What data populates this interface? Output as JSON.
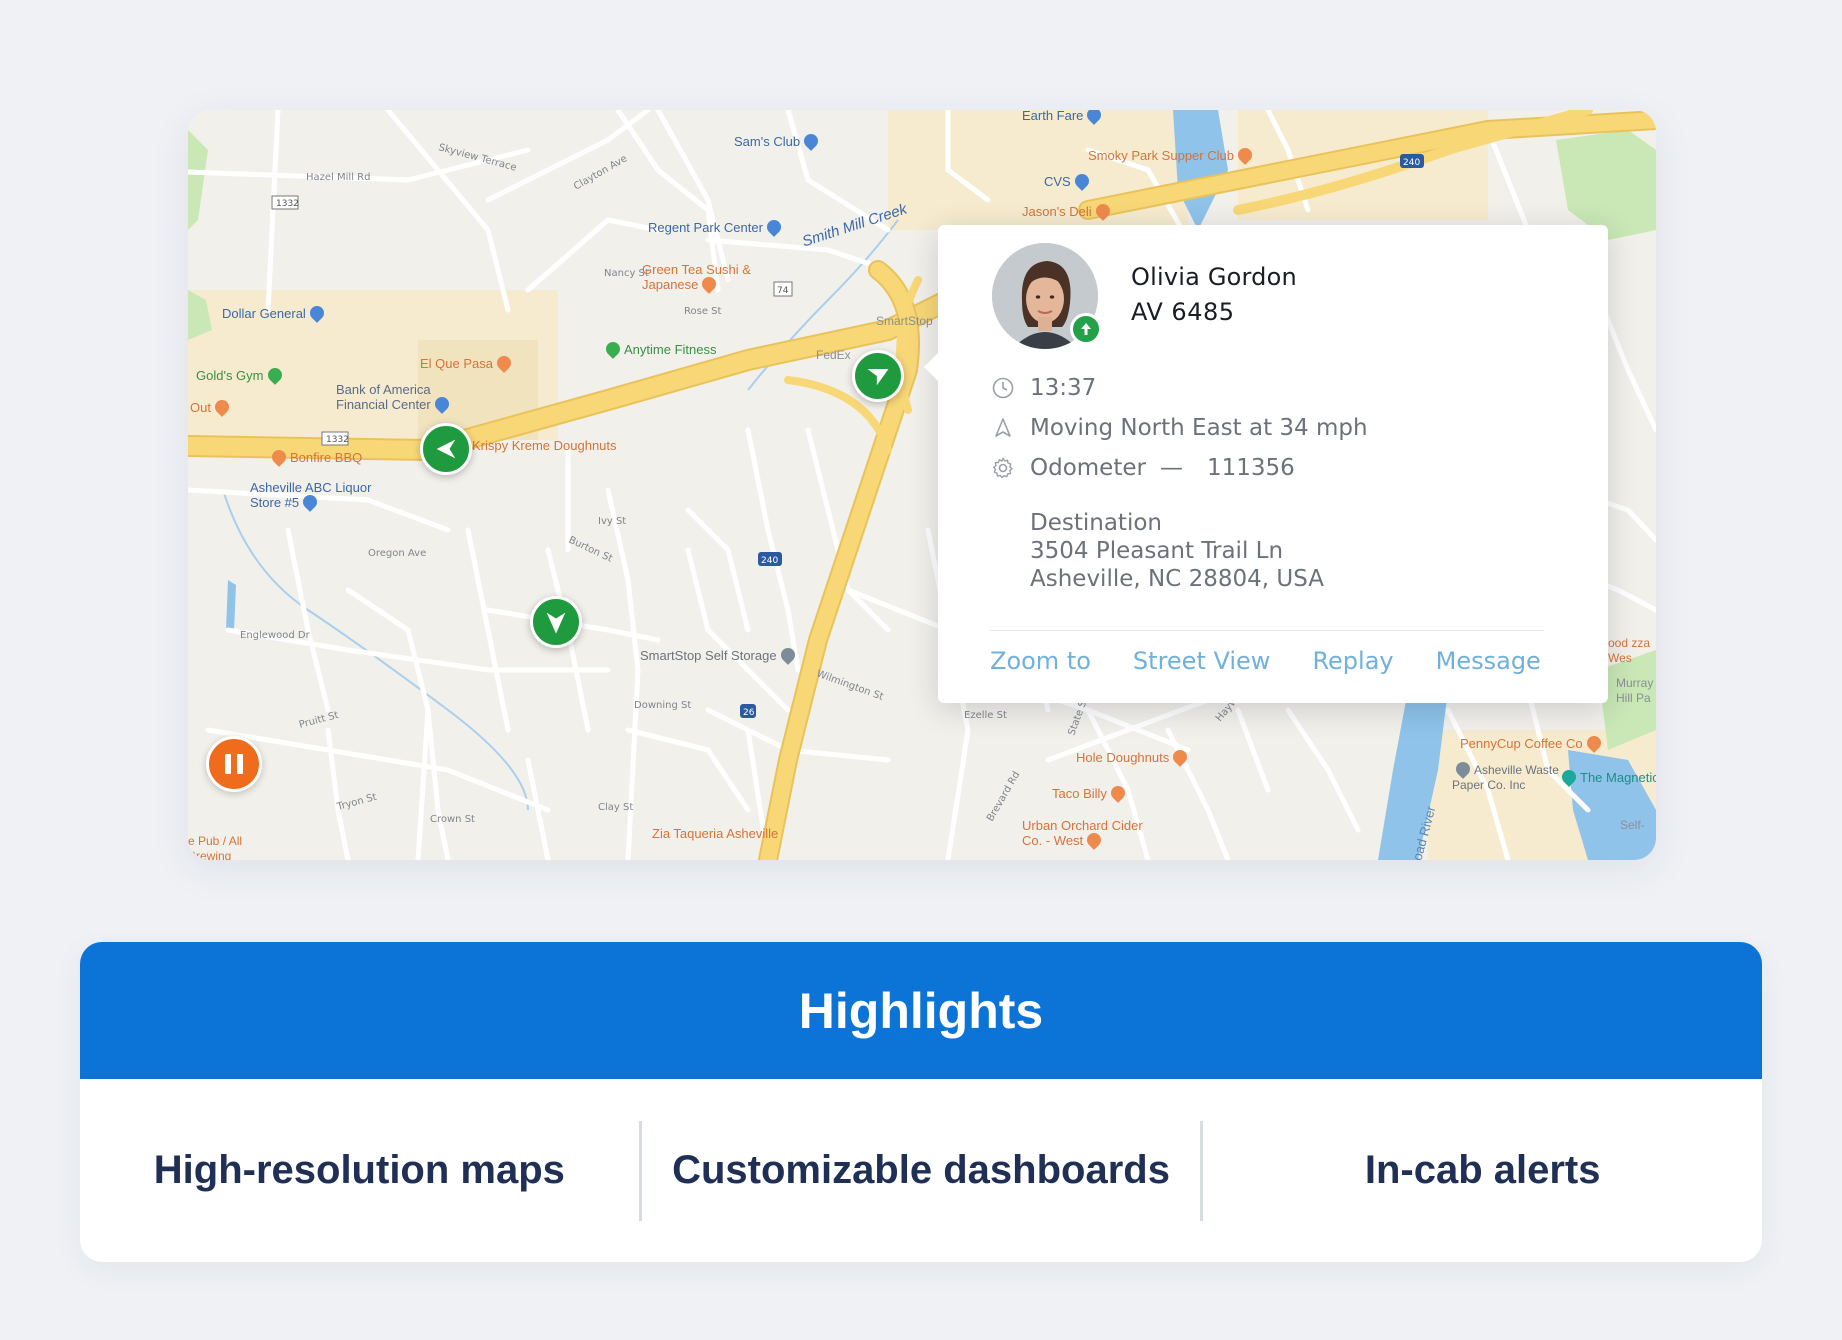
{
  "map": {
    "pois": [
      {
        "label": "Earth Fare",
        "color": "blue"
      },
      {
        "label": "Sam's Club",
        "color": "blue"
      },
      {
        "label": "Smoky Park Supper Club",
        "color": "orange"
      },
      {
        "label": "CVS",
        "color": "blue"
      },
      {
        "label": "Jason's Deli",
        "color": "orange"
      },
      {
        "label": "Regent Park Center",
        "color": "blue"
      },
      {
        "label": "Smith Mill Creek",
        "color": "blue"
      },
      {
        "label": "Green Tea Sushi & Japanese",
        "color": "orange"
      },
      {
        "label": "Dollar General",
        "color": "blue"
      },
      {
        "label": "Anytime Fitness",
        "color": "green"
      },
      {
        "label": "SmartStop",
        "color": "gray"
      },
      {
        "label": "FedEx",
        "color": "gray"
      },
      {
        "label": "El Que Pasa",
        "color": "orange"
      },
      {
        "label": "Gold's Gym",
        "color": "green"
      },
      {
        "label": "Bank of America Financial Center",
        "color": "blue"
      },
      {
        "label": "Out",
        "color": "orange"
      },
      {
        "label": "Krispy Kreme Doughnuts",
        "color": "orange"
      },
      {
        "label": "Bonfire BBQ",
        "color": "orange"
      },
      {
        "label": "Asheville ABC Liquor Store #5",
        "color": "blue"
      },
      {
        "label": "SmartStop Self Storage",
        "color": "gray"
      },
      {
        "label": "Hole Doughnuts",
        "color": "orange"
      },
      {
        "label": "Taco Billy",
        "color": "orange"
      },
      {
        "label": "Urban Orchard Cider Co. - West",
        "color": "orange"
      },
      {
        "label": "PennyCup Coffee Co",
        "color": "orange"
      },
      {
        "label": "The Magnetic",
        "color": "teal"
      },
      {
        "label": "Asheville Waste Paper Co. Inc",
        "color": "gray"
      },
      {
        "label": "Zia Taqueria Asheville",
        "color": "orange"
      },
      {
        "label": "e Pub / All Brewing",
        "color": "orange"
      },
      {
        "label": "Broad River",
        "color": "gray"
      },
      {
        "label": "Murray Hill Pa",
        "color": "gray"
      },
      {
        "label": "Self-",
        "color": "gray"
      },
      {
        "label": "ood zza Wes",
        "color": "orange"
      }
    ],
    "streets": [
      "Hazel Mill Rd",
      "Skyview Terrace",
      "Clayton Ave",
      "Nancy St",
      "Rose St",
      "Oregon Ave",
      "Ivy St",
      "Burton St",
      "Downing St",
      "Crown St",
      "Tryon St",
      "Pruitt St",
      "Englewood Dr",
      "Clay St",
      "Wilmington St",
      "Ezelle St",
      "Haywood Rd",
      "State St",
      "Brevard Rd"
    ],
    "route_shields": [
      "1332",
      "1332",
      "240",
      "240",
      "74",
      "26"
    ],
    "colors": {
      "highway": "#f8d777",
      "water": "#8fc3ea",
      "park": "#c9e8b5",
      "vehicle": "#1f9a3e",
      "pause": "#ee6c1b"
    }
  },
  "popup": {
    "driver_name": "Olivia Gordon",
    "vehicle_id": "AV 6485",
    "status_icon": "arrow-up-icon",
    "time": "13:37",
    "movement": "Moving North East at 34 mph",
    "odometer_label": "Odometer",
    "odometer_sep": "—",
    "odometer_value": "111356",
    "destination_label": "Destination",
    "destination_line1": "3504 Pleasant Trail Ln",
    "destination_line2": "Asheville, NC 28804, USA",
    "actions": {
      "zoom": "Zoom to",
      "street_view": "Street View",
      "replay": "Replay",
      "message": "Message"
    },
    "action_color": "#6fb0de"
  },
  "highlights": {
    "title": "Highlights",
    "items": [
      "High-resolution maps",
      "Customizable dashboards",
      "In-cab alerts"
    ],
    "header_color": "#0b74d6",
    "text_color": "#1f2f55"
  }
}
